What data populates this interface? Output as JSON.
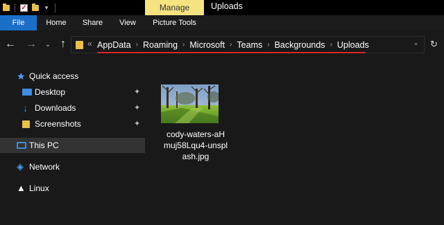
{
  "titlebar": {
    "manage_tab": "Manage",
    "window_title": "Uploads"
  },
  "ribbon": {
    "tabs": [
      "File",
      "Home",
      "Share",
      "View",
      "Picture Tools"
    ]
  },
  "nav": {
    "back_icon": "←",
    "forward_icon": "→",
    "recent_icon": "⌄",
    "up_icon": "↑",
    "more_icon": "«",
    "dropdown_icon": "⌄",
    "refresh_icon": "↻"
  },
  "address": {
    "crumbs": [
      "AppData",
      "Roaming",
      "Microsoft",
      "Teams",
      "Backgrounds",
      "Uploads"
    ],
    "separator": "›"
  },
  "sidebar": {
    "items": [
      {
        "label": "Quick access",
        "icon": "star-icon"
      },
      {
        "label": "Desktop",
        "icon": "desktop-icon",
        "pinned": true
      },
      {
        "label": "Downloads",
        "icon": "download-icon",
        "pinned": true
      },
      {
        "label": "Screenshots",
        "icon": "folder-icon",
        "pinned": true
      },
      {
        "label": "This PC",
        "icon": "computer-icon",
        "selected": true
      },
      {
        "label": "Network",
        "icon": "network-icon"
      },
      {
        "label": "Linux",
        "icon": "linux-icon"
      }
    ],
    "pin_glyph": "📌"
  },
  "main": {
    "files": [
      {
        "name": "cody-waters-aHmuj58Lqu4-unsplash.jpg",
        "display_lines": [
          "cody-waters-aH",
          "muj58Lqu4-unspl",
          "ash.jpg"
        ]
      }
    ]
  },
  "colors": {
    "accent_blue": "#1a6fc9",
    "manage_yellow": "#f4e37f",
    "underline_red": "#d62828",
    "background": "#191919"
  }
}
